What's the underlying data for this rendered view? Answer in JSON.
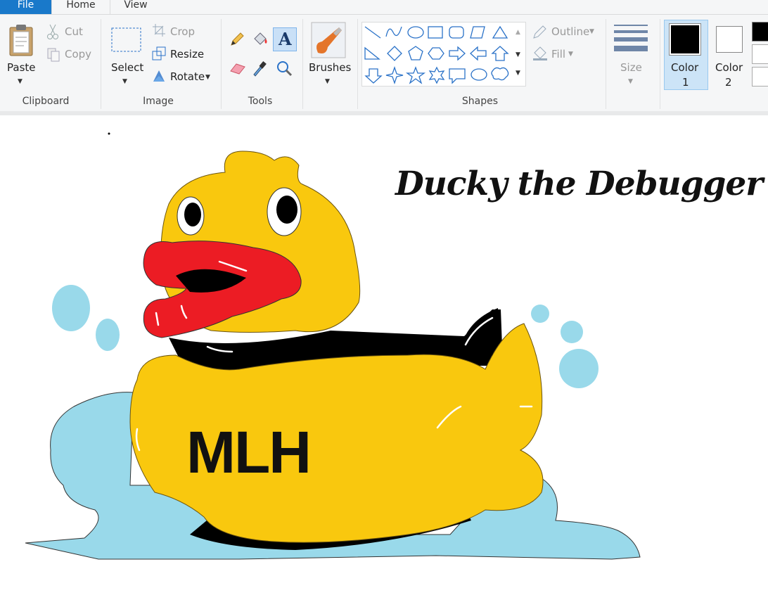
{
  "tabs": {
    "file": "File",
    "home": "Home",
    "view": "View"
  },
  "clipboard": {
    "paste": "Paste",
    "cut": "Cut",
    "copy": "Copy",
    "group": "Clipboard"
  },
  "image": {
    "select": "Select",
    "crop": "Crop",
    "resize": "Resize",
    "rotate": "Rotate",
    "group": "Image"
  },
  "tools": {
    "group": "Tools"
  },
  "brushes": {
    "label": "Brushes"
  },
  "shapes": {
    "outline": "Outline",
    "fill": "Fill",
    "group": "Shapes"
  },
  "size": {
    "label": "Size"
  },
  "colors": {
    "color1_a": "Color",
    "color1_b": "1",
    "color2_a": "Color",
    "color2_b": "2",
    "color1": "#000000",
    "color2": "#ffffff"
  },
  "drawing": {
    "title": "Ducky the Debugger",
    "shirt_text": "MLH",
    "duck_color": "#f9c80e",
    "beak_color": "#ec1c24",
    "water_color": "#99d9ea"
  }
}
